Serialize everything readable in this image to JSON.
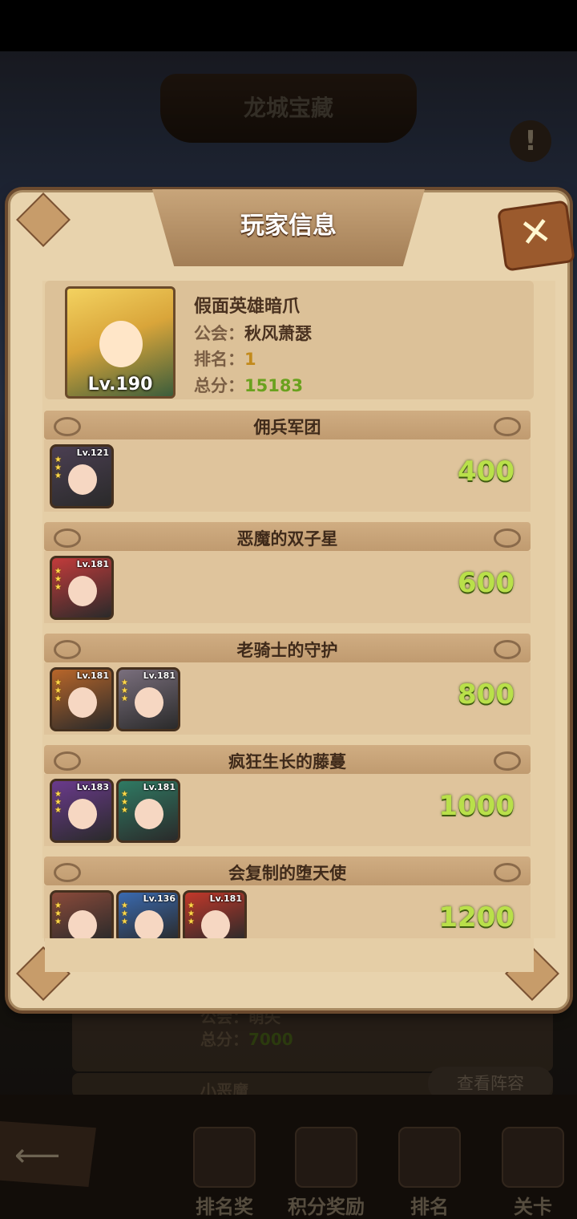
{
  "background": {
    "title": "龙城宝藏",
    "rows": [
      {
        "guild_label": "公会：",
        "guild": "萌失",
        "score_label": "总分：",
        "score": "7000"
      },
      {
        "name": "小恶魔",
        "button": "查看阵容"
      }
    ]
  },
  "panel": {
    "title": "玩家信息",
    "close_icon": "close-x-icon"
  },
  "player": {
    "avatar_level": "Lv.190",
    "name": "假面英雄暗爪",
    "guild_label": "公会：",
    "guild": "秋风萧瑟",
    "rank_label": "排名：",
    "rank": "1",
    "score_label": "总分：",
    "score": "15183"
  },
  "sections": [
    {
      "title": "佣兵军团",
      "score": "400",
      "heroes": [
        {
          "level": "Lv.121",
          "color": "#4b3f52"
        }
      ]
    },
    {
      "title": "恶魔的双子星",
      "score": "600",
      "heroes": [
        {
          "level": "Lv.181",
          "color": "#c23b3b"
        }
      ]
    },
    {
      "title": "老骑士的守护",
      "score": "800",
      "heroes": [
        {
          "level": "Lv.181",
          "color": "#b8662a"
        },
        {
          "level": "Lv.181",
          "color": "#7a6f7d"
        }
      ]
    },
    {
      "title": "疯狂生长的藤蔓",
      "score": "1000",
      "heroes": [
        {
          "level": "Lv.183",
          "color": "#6a3a8c"
        },
        {
          "level": "Lv.181",
          "color": "#2f7a63"
        }
      ]
    },
    {
      "title": "会复制的堕天使",
      "score": "1200",
      "heroes": [
        {
          "level": "",
          "color": "#8a4a3a"
        },
        {
          "level": "Lv.136",
          "color": "#3a6ab0"
        },
        {
          "level": "Lv.181",
          "color": "#c2382a"
        }
      ]
    }
  ],
  "bottom_nav": [
    {
      "label": "排名奖",
      "icon": "trophy-icon"
    },
    {
      "label": "积分奖励",
      "icon": "scroll-icon"
    },
    {
      "label": "排名",
      "icon": "ranking-icon"
    },
    {
      "label": "关卡",
      "icon": "stage-icon"
    }
  ],
  "back_icon": "back-arrow-icon"
}
